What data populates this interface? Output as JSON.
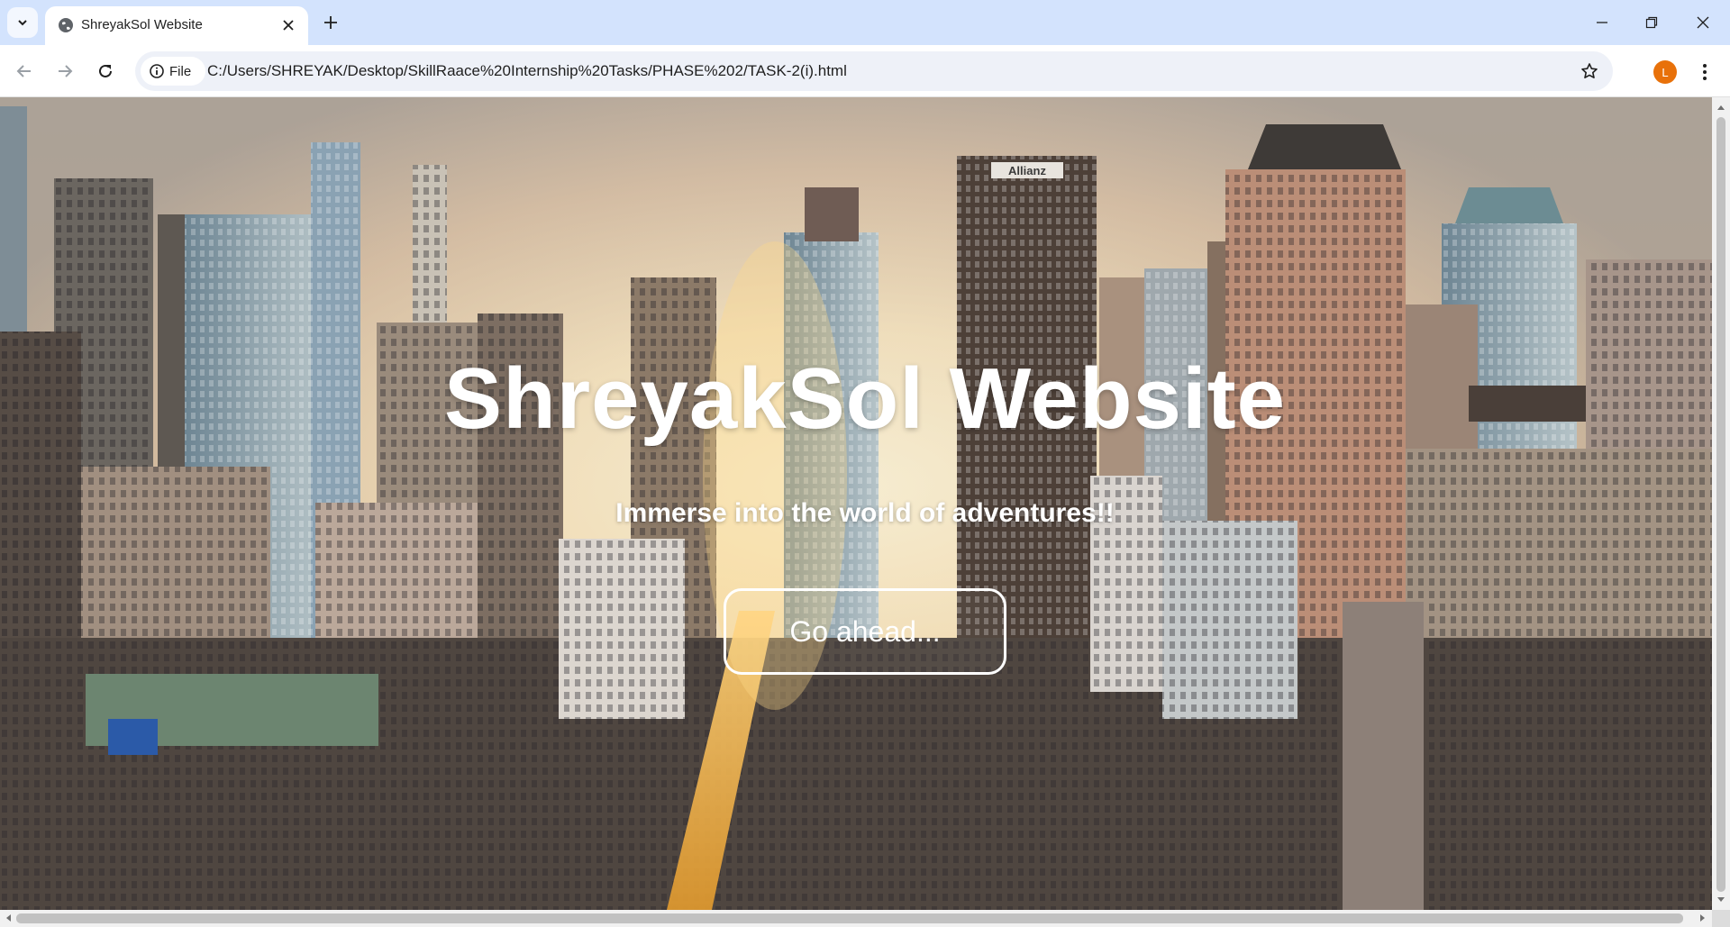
{
  "browser": {
    "tab_title": "ShreyakSol Website",
    "omnibox_chip": "File",
    "url": "C:/Users/SHREYAK/Desktop/SkillRaace%20Internship%20Tasks/PHASE%202/TASK-2(i).html",
    "profile_initial": "L",
    "icons": [
      "tab-search-icon",
      "globe-icon",
      "close-icon",
      "plus-icon",
      "minimize-icon",
      "restore-icon",
      "window-close-icon",
      "back-icon",
      "forward-icon",
      "reload-icon",
      "info-icon",
      "star-icon",
      "kebab-menu-icon"
    ]
  },
  "hero": {
    "title": "ShreyakSol Website",
    "subtitle": "Immerse into the world of adventures!!",
    "button_label": "Go ahead..."
  },
  "colors": {
    "tabbar": "#d3e3fd",
    "avatar": "#e8710a",
    "hero_text": "#ffffff"
  }
}
